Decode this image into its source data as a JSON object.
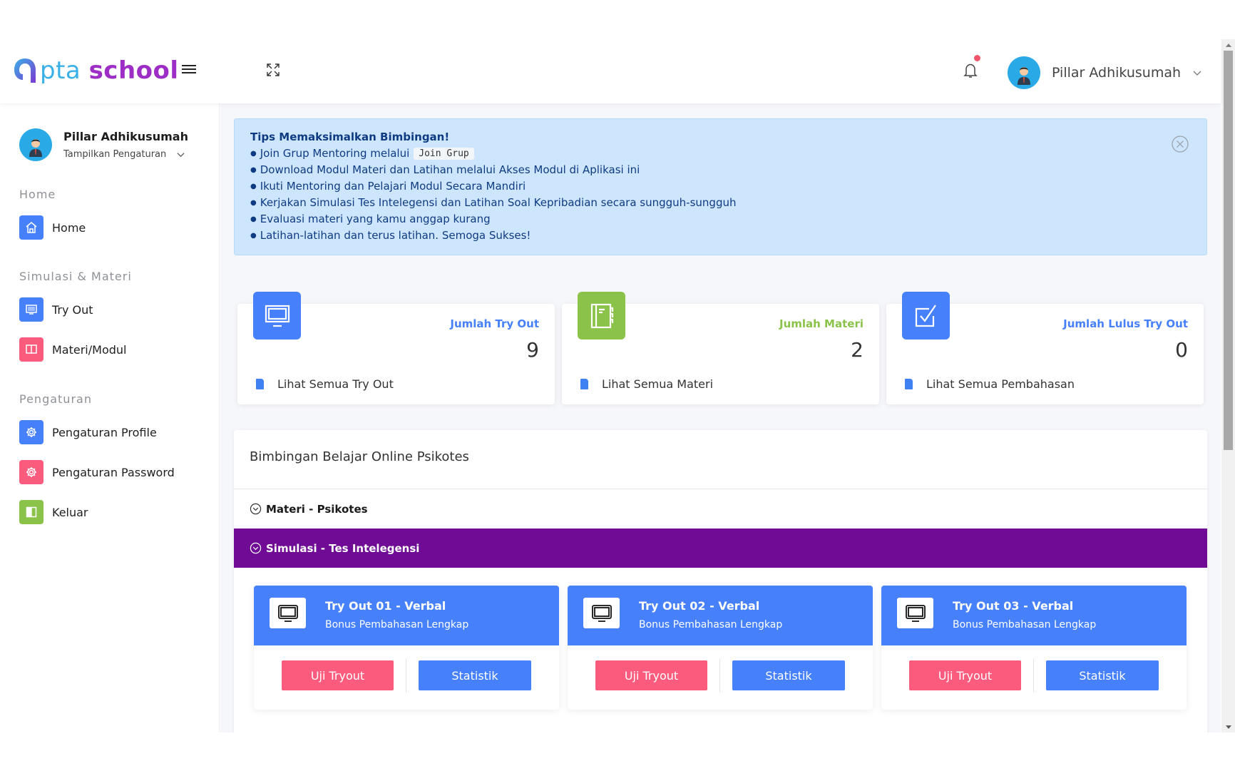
{
  "header": {
    "logo": {
      "part1": "pta",
      "part2": "school"
    },
    "user_name": "Pillar Adhikusumah",
    "notification_unread": true
  },
  "sidebar": {
    "user_name": "Pillar Adhikusumah",
    "settings_label": "Tampilkan Pengaturan",
    "sections": [
      {
        "title": "Home",
        "items": [
          {
            "label": "Home",
            "icon": "home-icon",
            "color": "#4680fb"
          }
        ]
      },
      {
        "title": "Simulasi & Materi",
        "items": [
          {
            "label": "Try Out",
            "icon": "monitor-icon",
            "color": "#4680fb"
          },
          {
            "label": "Materi/Modul",
            "icon": "book-icon",
            "color": "#fb5b7c"
          }
        ]
      },
      {
        "title": "Pengaturan",
        "items": [
          {
            "label": "Pengaturan Profile",
            "icon": "gear-icon",
            "color": "#4680fb"
          },
          {
            "label": "Pengaturan Password",
            "icon": "gear-icon",
            "color": "#fb5b7c"
          },
          {
            "label": "Keluar",
            "icon": "logout-icon",
            "color": "#8bc34a"
          }
        ]
      }
    ]
  },
  "alert": {
    "title": "Tips Memaksimalkan Bimbingan!",
    "join_prefix": "Join Grup Mentoring melalui",
    "join_chip": "Join Grup",
    "lines": [
      "Download Modul Materi dan Latihan melalui Akses Modul di Aplikasi ini",
      "Ikuti Mentoring dan Pelajari Modul Secara Mandiri",
      "Kerjakan Simulasi Tes Intelegensi dan Latihan Soal Kepribadian secara sungguh-sungguh",
      "Evaluasi materi yang kamu anggap kurang",
      "Latihan-latihan dan terus latihan. Semoga Sukses!"
    ],
    "bg_color": "#cde6fd",
    "text_color": "#0f3b82"
  },
  "stats": [
    {
      "title": "Jumlah Try Out",
      "value": "9",
      "link": "Lihat Semua Try Out",
      "color": "#4680fb",
      "icon": "monitor-icon"
    },
    {
      "title": "Jumlah Materi",
      "value": "2",
      "link": "Lihat Semua Materi",
      "color": "#8bc34a",
      "icon": "notebook-icon"
    },
    {
      "title": "Jumlah Lulus Try Out",
      "value": "0",
      "link": "Lihat Semua Pembahasan",
      "color": "#4680fb",
      "icon": "checkbox-icon"
    }
  ],
  "panel": {
    "title": "Bimbingan Belajar Online Psikotes",
    "accordions": [
      {
        "label": "Materi - Psikotes",
        "expanded": false
      },
      {
        "label": "Simulasi - Tes Intelegensi",
        "expanded": true,
        "color": "#6f0b95"
      }
    ],
    "tryouts": [
      {
        "title": "Try Out 01 - Verbal",
        "subtitle": "Bonus Pembahasan Lengkap",
        "primary_btn": "Uji Tryout",
        "secondary_btn": "Statistik"
      },
      {
        "title": "Try Out 02 - Verbal",
        "subtitle": "Bonus Pembahasan Lengkap",
        "primary_btn": "Uji Tryout",
        "secondary_btn": "Statistik"
      },
      {
        "title": "Try Out 03 - Verbal",
        "subtitle": "Bonus Pembahasan Lengkap",
        "primary_btn": "Uji Tryout",
        "secondary_btn": "Statistik"
      }
    ]
  }
}
